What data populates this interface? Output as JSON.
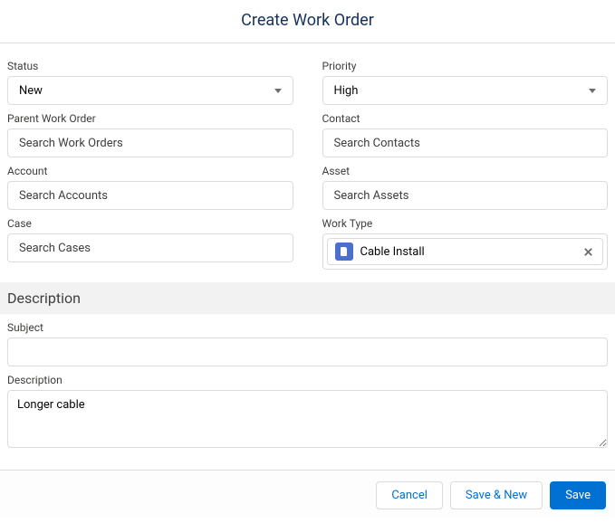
{
  "title": "Create Work Order",
  "fields": {
    "status": {
      "label": "Status",
      "value": "New"
    },
    "priority": {
      "label": "Priority",
      "value": "High"
    },
    "parent_wo": {
      "label": "Parent Work Order",
      "placeholder": "Search Work Orders"
    },
    "contact": {
      "label": "Contact",
      "placeholder": "Search Contacts"
    },
    "account": {
      "label": "Account",
      "placeholder": "Search Accounts"
    },
    "asset": {
      "label": "Asset",
      "placeholder": "Search Assets"
    },
    "case": {
      "label": "Case",
      "placeholder": "Search Cases"
    },
    "work_type": {
      "label": "Work Type",
      "pill": "Cable Install"
    }
  },
  "section_description": "Description",
  "subject": {
    "label": "Subject",
    "value": ""
  },
  "description": {
    "label": "Description",
    "value": "Longer cable"
  },
  "buttons": {
    "cancel": "Cancel",
    "save_new": "Save & New",
    "save": "Save"
  }
}
